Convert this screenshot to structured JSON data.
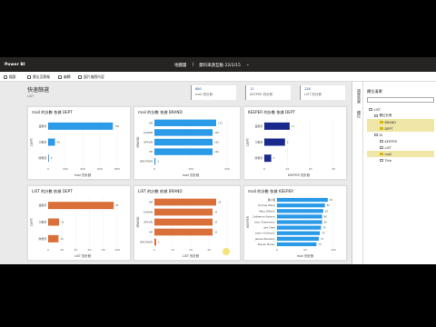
{
  "titlebar": {
    "app": "Power BI",
    "center_left": "地圖層",
    "center_right": "資料來源互動 22/2/15"
  },
  "toolbar": {
    "items": [
      {
        "label": "檔案",
        "icon": "file-icon"
      },
      {
        "label": "匯出至簡報",
        "icon": "export-icon"
      },
      {
        "label": "編輯",
        "icon": "edit-icon"
      },
      {
        "label": "圖片檢閱內容",
        "icon": "image-icon"
      }
    ]
  },
  "page": {
    "title": "快速篩選",
    "subtitle": "LIST"
  },
  "kpis": [
    {
      "value": "880",
      "label": "mail 的計數"
    },
    {
      "value": "11",
      "label": "KEEPER 的計數"
    },
    {
      "value": "128",
      "label": "LIST 的計數"
    }
  ],
  "colors": {
    "blue": "#2b9be8",
    "navy": "#1a2a8c",
    "orange": "#d9703a"
  },
  "charts": [
    {
      "title": "mail 的計數 依據 DEPT",
      "axis": "DEPT",
      "xlabel": "mail 的計數",
      "color": "blue",
      "chart_data": {
        "type": "bar",
        "categories": [
          "業務部",
          "工務部",
          "財務部"
        ],
        "values": [
          750,
          80,
          9
        ],
        "xlim": [
          0,
          800
        ],
        "xticks": [
          "0",
          "200",
          "400",
          "600",
          "800"
        ]
      }
    },
    {
      "title": "mail 的計數 依據 BRAND",
      "axis": "BRAND",
      "xlabel": "mail 的計數",
      "color": "blue",
      "chart_data": {
        "type": "bar",
        "categories": [
          "3M",
          "CANON",
          "EPSON",
          "HP",
          "BROTHER"
        ],
        "values": [
          170,
          160,
          160,
          160,
          3
        ],
        "xlim": [
          0,
          200
        ],
        "xticks": [
          "0",
          "100",
          "200"
        ]
      }
    },
    {
      "title": "KEEPER 的計數 依據 DEPT",
      "axis": "DEPT",
      "xlabel": "KEEPER 的計數",
      "color": "navy",
      "chart_data": {
        "type": "bar",
        "categories": [
          "業務部",
          "工務部",
          "財務部"
        ],
        "values": [
          11,
          9,
          3
        ],
        "xlim": [
          0,
          30
        ],
        "xticks": [
          "0",
          "10",
          "20",
          "30"
        ]
      }
    },
    {
      "title": "LIST 的計數 依據 DEPT",
      "axis": "DEPT",
      "xlabel": "LIST 的計數",
      "color": "orange",
      "chart_data": {
        "type": "bar",
        "categories": [
          "業務部",
          "工務部",
          "財務部"
        ],
        "values": [
          95,
          16,
          15
        ],
        "xlim": [
          0,
          100
        ],
        "xticks": [
          "0",
          "20",
          "40",
          "60",
          "80",
          "100"
        ]
      }
    },
    {
      "title": "LIST 的計數 依據 BRAND",
      "axis": "BRAND",
      "xlabel": "LIST 的計數",
      "color": "orange",
      "chart_data": {
        "type": "bar",
        "categories": [
          "3M",
          "CANON",
          "EPSON",
          "HP",
          "BROTHER"
        ],
        "values": [
          34,
          32,
          32,
          32,
          1
        ],
        "xlim": [
          0,
          40
        ],
        "xticks": [
          "0",
          "10",
          "20",
          "30",
          "40"
        ]
      }
    },
    {
      "title": "mail 的計數 依據 KEEPER",
      "axis": "KEEPER",
      "xlabel": "mail 的計數",
      "color": "blue",
      "chart_data": {
        "type": "bar",
        "categories": [
          "黃小姐",
          "Andrew Wang",
          "Mary Willson",
          "Catherine Sworon",
          "Jack Chamerson",
          "Joe Chen",
          "Jason Anderson",
          "James Woodson",
          "Steven Brown"
        ],
        "values": [
          90,
          85,
          82,
          80,
          80,
          78,
          76,
          74,
          70
        ],
        "xlim": [
          0,
          100
        ],
        "xticks": [
          "0",
          "50",
          "100"
        ]
      }
    }
  ],
  "fields_panel": {
    "title": "欄位清單",
    "tabs": [
      "視覺效果",
      "欄位"
    ],
    "items": [
      {
        "label": "LIST",
        "level": 1,
        "checked": false,
        "highlight": false
      },
      {
        "label": "欄位計數",
        "level": 2,
        "checked": false,
        "highlight": false
      },
      {
        "label": "BRAND",
        "level": 3,
        "checked": true,
        "highlight": true
      },
      {
        "label": "DEPT",
        "level": 3,
        "checked": true,
        "highlight": true
      },
      {
        "label": "ID",
        "level": 2,
        "checked": false,
        "highlight": false
      },
      {
        "label": "KEEPER",
        "level": 3,
        "checked": false,
        "highlight": false
      },
      {
        "label": "LIST",
        "level": 3,
        "checked": false,
        "highlight": false
      },
      {
        "label": "mail",
        "level": 3,
        "checked": true,
        "highlight": true
      },
      {
        "label": "Title",
        "level": 3,
        "checked": false,
        "highlight": false
      }
    ]
  }
}
